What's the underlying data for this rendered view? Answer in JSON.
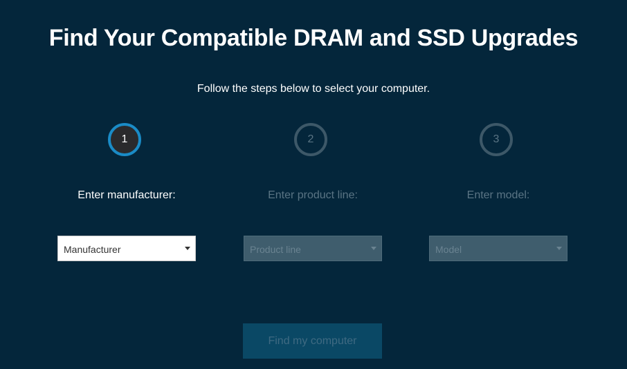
{
  "header": {
    "title": "Find Your Compatible DRAM and SSD Upgrades",
    "subtitle": "Follow the steps below to select your computer."
  },
  "steps": [
    {
      "number": "1",
      "label": "Enter manufacturer:",
      "select_value": "Manufacturer",
      "state": "active"
    },
    {
      "number": "2",
      "label": "Enter product line:",
      "select_value": "Product line",
      "state": "disabled"
    },
    {
      "number": "3",
      "label": "Enter model:",
      "select_value": "Model",
      "state": "disabled"
    }
  ],
  "actions": {
    "find_label": "Find my computer"
  },
  "colors": {
    "background": "#04263b",
    "accent": "#1a8bc6",
    "disabled_button": "#0a4865"
  },
  "icons": {
    "dropdown": "caret-down-icon"
  }
}
